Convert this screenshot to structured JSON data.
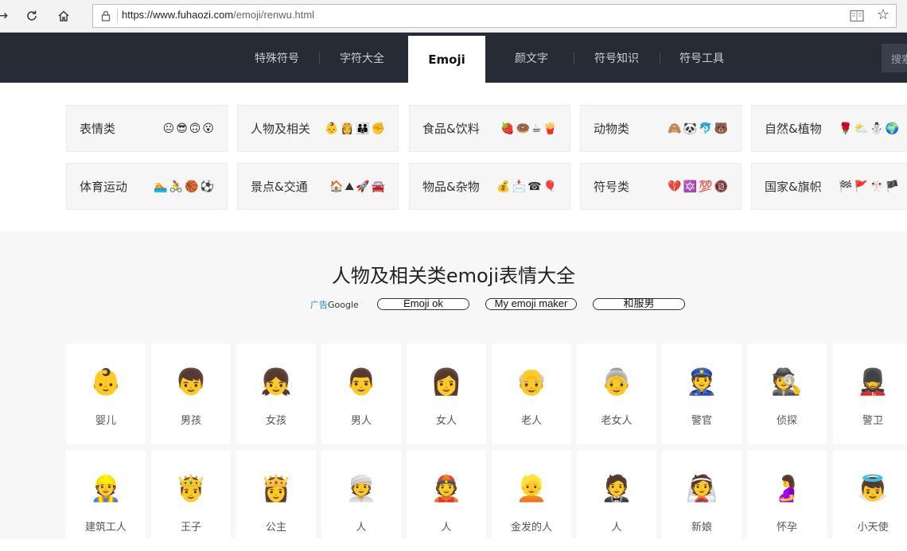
{
  "browser": {
    "url_host": "https://www.fuhaozi.com",
    "url_path": "/emoji/renwu.html"
  },
  "nav": {
    "items": [
      "特殊符号",
      "字符大全",
      "Emoji",
      "颜文字",
      "符号知识",
      "符号工具"
    ],
    "active": "Emoji",
    "search_label": "搜索"
  },
  "categories": [
    {
      "label": "表情类",
      "emojis": "😐😎🙃😮"
    },
    {
      "label": "人物及相关",
      "emojis": "👶👸👪✊"
    },
    {
      "label": "食品&饮料",
      "emojis": "🍓🍩☕🍟"
    },
    {
      "label": "动物类",
      "emojis": "🙈🐼🐬🐻"
    },
    {
      "label": "自然&植物",
      "emojis": "🌹⛅⛄🌍"
    },
    {
      "label": "体育运动",
      "emojis": "🏊🚴🏀⚽"
    },
    {
      "label": "景点&交通",
      "emojis": "🏠⛰🚀🚘"
    },
    {
      "label": "物品&杂物",
      "emojis": "💰📩☎🎈"
    },
    {
      "label": "符号类",
      "emojis": "💔🔯💯🔞"
    },
    {
      "label": "国家&旗帜",
      "emojis": "🏁🚩🎌🏴"
    }
  ],
  "main": {
    "title": "人物及相关类emoji表情大全",
    "ad_label": "广告",
    "ad_brand": "Google",
    "ad_links": [
      "Emoji ok",
      "My emoji maker",
      "和服男"
    ]
  },
  "emoji_rows": [
    [
      {
        "emoji": "👶",
        "name": "婴儿"
      },
      {
        "emoji": "👦",
        "name": "男孩"
      },
      {
        "emoji": "👧",
        "name": "女孩"
      },
      {
        "emoji": "👨",
        "name": "男人"
      },
      {
        "emoji": "👩",
        "name": "女人"
      },
      {
        "emoji": "👴",
        "name": "老人"
      },
      {
        "emoji": "👵",
        "name": "老女人"
      },
      {
        "emoji": "👮",
        "name": "警官"
      },
      {
        "emoji": "🕵",
        "name": "侦探"
      },
      {
        "emoji": "💂",
        "name": "警卫"
      }
    ],
    [
      {
        "emoji": "👷",
        "name": "建筑工人"
      },
      {
        "emoji": "🤴",
        "name": "王子"
      },
      {
        "emoji": "👸",
        "name": "公主"
      },
      {
        "emoji": "👳",
        "name": "人"
      },
      {
        "emoji": "👲",
        "name": "人"
      },
      {
        "emoji": "👱",
        "name": "金发的人"
      },
      {
        "emoji": "🤵",
        "name": "人"
      },
      {
        "emoji": "👰",
        "name": "新娘"
      },
      {
        "emoji": "🤰",
        "name": "怀孕"
      },
      {
        "emoji": "👼",
        "name": "小天使"
      }
    ]
  ]
}
